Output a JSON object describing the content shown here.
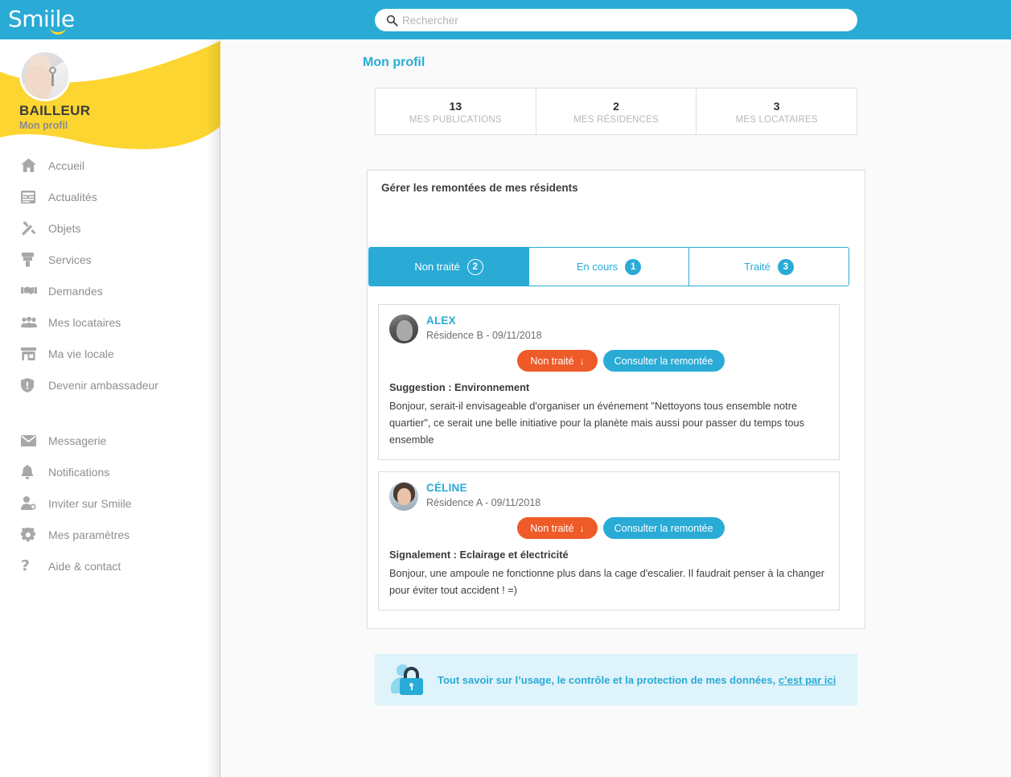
{
  "brand": {
    "name": "Smiile",
    "accent_blue": "#29abd6",
    "accent_yellow": "#fcd530",
    "accent_orange": "#ee5a28"
  },
  "topbar": {
    "search": {
      "placeholder": "Rechercher",
      "value": "",
      "icon": "search-icon"
    }
  },
  "sidebar": {
    "profile": {
      "name": "BAILLEUR",
      "subtitle": "Mon profil",
      "avatar": "profile-photo-keys"
    },
    "items": [
      {
        "label": "Accueil",
        "icon": "home-icon"
      },
      {
        "label": "Actualités",
        "icon": "news-icon"
      },
      {
        "label": "Objets",
        "icon": "tools-icon"
      },
      {
        "label": "Services",
        "icon": "paintbrush-icon"
      },
      {
        "label": "Demandes",
        "icon": "handshake-icon"
      },
      {
        "label": "Mes locataires",
        "icon": "people-icon"
      },
      {
        "label": "Ma vie locale",
        "icon": "shop-icon"
      },
      {
        "label": "Devenir ambassadeur",
        "icon": "shield-icon"
      }
    ],
    "items_secondary": [
      {
        "label": "Messagerie",
        "icon": "envelope-icon"
      },
      {
        "label": "Notifications",
        "icon": "bell-icon"
      },
      {
        "label": "Inviter sur Smiile",
        "icon": "add-user-icon"
      },
      {
        "label": "Mes paramètres",
        "icon": "gear-icon"
      },
      {
        "label": "Aide & contact",
        "icon": "question-mark-icon"
      }
    ]
  },
  "main": {
    "page_title": "Mon profil",
    "stats": [
      {
        "value": "13",
        "label": "MES PUBLICATIONS"
      },
      {
        "value": "2",
        "label": "MES RÉSIDENCES"
      },
      {
        "value": "3",
        "label": "MES LOCATAIRES"
      }
    ],
    "panel": {
      "title": "Gérer les remontées de mes résidents",
      "tabs": [
        {
          "label": "Non traité",
          "count": "2",
          "active": true
        },
        {
          "label": "En cours",
          "count": "1",
          "active": false
        },
        {
          "label": "Traité",
          "count": "3",
          "active": false
        }
      ],
      "reports": [
        {
          "author": "ALEX",
          "meta": "Résidence B - 09/11/2018",
          "avatar": "avatar-alex",
          "status_label": "Non traité",
          "status_arrow": "↓",
          "consult_label": "Consulter la remontée",
          "subject": "Suggestion : Environnement",
          "body": "Bonjour, serait-il envisageable d'organiser un événement \"Nettoyons tous ensemble notre quartier\", ce serait une belle initiative pour la planète mais aussi pour passer du temps tous ensemble"
        },
        {
          "author": "CÉLINE",
          "meta": "Résidence A - 09/11/2018",
          "avatar": "avatar-celine",
          "status_label": "Non traité",
          "status_arrow": "↓",
          "consult_label": "Consulter la remontée",
          "subject": "Signalement : Eclairage et électricité",
          "body": "Bonjour, une ampoule ne fonctionne plus dans la cage d'escalier. Il faudrait penser à la changer pour éviter tout accident ! =)"
        }
      ]
    },
    "privacy": {
      "icon": "user-lock-icon",
      "text": "Tout savoir sur l’usage, le contrôle et la protection de mes données,",
      "link_label": "c’est par ici"
    }
  }
}
